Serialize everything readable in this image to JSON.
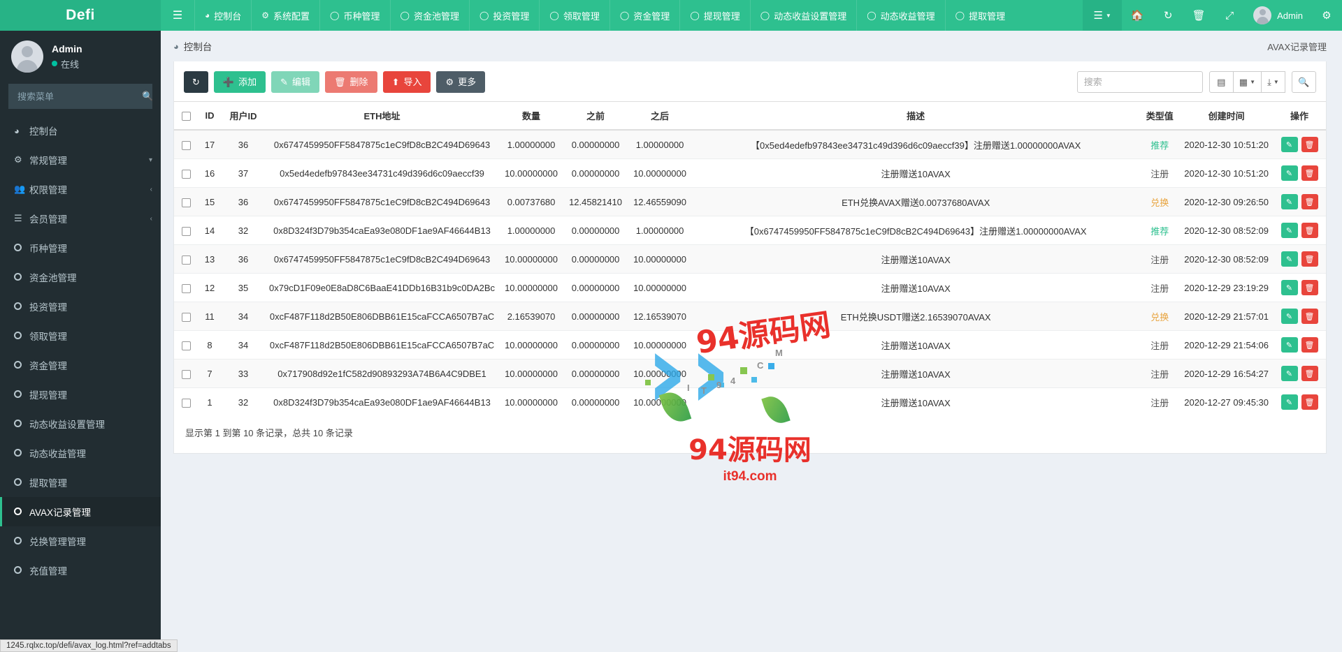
{
  "brand": "Defi",
  "topnav": {
    "toggle_icon": "hamburger-icon",
    "items": [
      {
        "label": "控制台",
        "icon": "dashboard-icon"
      },
      {
        "label": "系统配置",
        "icon": "gear-icon"
      },
      {
        "label": "币种管理",
        "icon": "circle-icon"
      },
      {
        "label": "资金池管理",
        "icon": "circle-icon"
      },
      {
        "label": "投资管理",
        "icon": "circle-icon"
      },
      {
        "label": "领取管理",
        "icon": "circle-icon"
      },
      {
        "label": "资金管理",
        "icon": "circle-icon"
      },
      {
        "label": "提现管理",
        "icon": "circle-icon"
      },
      {
        "label": "动态收益设置管理",
        "icon": "circle-icon"
      },
      {
        "label": "动态收益管理",
        "icon": "circle-icon"
      },
      {
        "label": "提取管理",
        "icon": "circle-icon"
      }
    ],
    "right": {
      "menu_icon": "list-menu-icon",
      "home_icon": "home-icon",
      "refresh_icon": "refresh-icon",
      "trash_icon": "trash-icon",
      "fullscreen_icon": "expand-icon",
      "user_label": "Admin",
      "gear_icon": "gears-icon"
    }
  },
  "sidebar": {
    "user_name": "Admin",
    "user_status": "在线",
    "search_placeholder": "搜索菜单",
    "search_value": "",
    "items": [
      {
        "label": "控制台",
        "icon": "dashboard-icon",
        "type": "icon",
        "active": false,
        "caret": ""
      },
      {
        "label": "常规管理",
        "icon": "gears-icon",
        "type": "icon",
        "active": false,
        "caret": "▾"
      },
      {
        "label": "权限管理",
        "icon": "users-icon",
        "type": "icon",
        "active": false,
        "caret": "‹"
      },
      {
        "label": "会员管理",
        "icon": "list-icon",
        "type": "icon",
        "active": false,
        "caret": "‹"
      },
      {
        "label": "币种管理",
        "icon": "circle-icon",
        "type": "circle",
        "active": false,
        "caret": ""
      },
      {
        "label": "资金池管理",
        "icon": "circle-icon",
        "type": "circle",
        "active": false,
        "caret": ""
      },
      {
        "label": "投资管理",
        "icon": "circle-icon",
        "type": "circle",
        "active": false,
        "caret": ""
      },
      {
        "label": "领取管理",
        "icon": "circle-icon",
        "type": "circle",
        "active": false,
        "caret": ""
      },
      {
        "label": "资金管理",
        "icon": "circle-icon",
        "type": "circle",
        "active": false,
        "caret": ""
      },
      {
        "label": "提现管理",
        "icon": "circle-icon",
        "type": "circle",
        "active": false,
        "caret": ""
      },
      {
        "label": "动态收益设置管理",
        "icon": "circle-icon",
        "type": "circle",
        "active": false,
        "caret": ""
      },
      {
        "label": "动态收益管理",
        "icon": "circle-icon",
        "type": "circle",
        "active": false,
        "caret": ""
      },
      {
        "label": "提取管理",
        "icon": "circle-icon",
        "type": "circle",
        "active": false,
        "caret": ""
      },
      {
        "label": "AVAX记录管理",
        "icon": "circle-icon",
        "type": "circle",
        "active": true,
        "caret": ""
      },
      {
        "label": "兑换管理管理",
        "icon": "circle-icon",
        "type": "circle",
        "active": false,
        "caret": ""
      },
      {
        "label": "充值管理",
        "icon": "circle-icon",
        "type": "circle",
        "active": false,
        "caret": ""
      }
    ]
  },
  "breadcrumb": {
    "icon": "dashboard-icon",
    "label": "控制台",
    "right_label": "AVAX记录管理"
  },
  "toolbar": {
    "refresh_icon": "refresh-icon",
    "add_label": "添加",
    "edit_label": "编辑",
    "delete_label": "删除",
    "import_label": "导入",
    "more_label": "更多",
    "search_placeholder": "搜索",
    "search_value": "",
    "icon_buttons": [
      {
        "name": "columns-toggle-icon",
        "glyph": "▤",
        "caret": false
      },
      {
        "name": "grid-view-icon",
        "glyph": "▦",
        "caret": true
      },
      {
        "name": "export-icon",
        "glyph": "⤓",
        "caret": true
      },
      {
        "name": "search-icon",
        "glyph": "⌕",
        "caret": false
      }
    ]
  },
  "table": {
    "columns": [
      "",
      "ID",
      "用户ID",
      "ETH地址",
      "数量",
      "之前",
      "之后",
      "描述",
      "类型值",
      "创建时间",
      "操作"
    ],
    "rows": [
      {
        "id": "17",
        "uid": "36",
        "eth": "0x6747459950FF5847875c1eC9fD8cB2C494D69643",
        "amount": "1.00000000",
        "before": "0.00000000",
        "after": "1.00000000",
        "desc": "【0x5ed4edefb97843ee34731c49d396d6c09aeccf39】注册赠送1.00000000AVAX",
        "type": "推荐",
        "type_class": "type-tui",
        "time": "2020-12-30 10:51:20"
      },
      {
        "id": "16",
        "uid": "37",
        "eth": "0x5ed4edefb97843ee34731c49d396d6c09aeccf39",
        "amount": "10.00000000",
        "before": "0.00000000",
        "after": "10.00000000",
        "desc": "注册赠送10AVAX",
        "type": "注册",
        "type_class": "type-zhu",
        "time": "2020-12-30 10:51:20"
      },
      {
        "id": "15",
        "uid": "36",
        "eth": "0x6747459950FF5847875c1eC9fD8cB2C494D69643",
        "amount": "0.00737680",
        "before": "12.45821410",
        "after": "12.46559090",
        "desc": "ETH兑换AVAX赠送0.00737680AVAX",
        "type": "兑换",
        "type_class": "type-dui",
        "time": "2020-12-30 09:26:50"
      },
      {
        "id": "14",
        "uid": "32",
        "eth": "0x8D324f3D79b354caEa93e080DF1ae9AF46644B13",
        "amount": "1.00000000",
        "before": "0.00000000",
        "after": "1.00000000",
        "desc": "【0x6747459950FF5847875c1eC9fD8cB2C494D69643】注册赠送1.00000000AVAX",
        "type": "推荐",
        "type_class": "type-tui",
        "time": "2020-12-30 08:52:09"
      },
      {
        "id": "13",
        "uid": "36",
        "eth": "0x6747459950FF5847875c1eC9fD8cB2C494D69643",
        "amount": "10.00000000",
        "before": "0.00000000",
        "after": "10.00000000",
        "desc": "注册赠送10AVAX",
        "type": "注册",
        "type_class": "type-zhu",
        "time": "2020-12-30 08:52:09"
      },
      {
        "id": "12",
        "uid": "35",
        "eth": "0x79cD1F09e0E8aD8C6BaaE41DDb16B31b9c0DA2Bc",
        "amount": "10.00000000",
        "before": "0.00000000",
        "after": "10.00000000",
        "desc": "注册赠送10AVAX",
        "type": "注册",
        "type_class": "type-zhu",
        "time": "2020-12-29 23:19:29"
      },
      {
        "id": "11",
        "uid": "34",
        "eth": "0xcF487F118d2B50E806DBB61E15caFCCA6507B7aC",
        "amount": "2.16539070",
        "before": "0.00000000",
        "after": "12.16539070",
        "desc": "ETH兑换USDT赠送2.16539070AVAX",
        "type": "兑换",
        "type_class": "type-dui",
        "time": "2020-12-29 21:57:01"
      },
      {
        "id": "8",
        "uid": "34",
        "eth": "0xcF487F118d2B50E806DBB61E15caFCCA6507B7aC",
        "amount": "10.00000000",
        "before": "0.00000000",
        "after": "10.00000000",
        "desc": "注册赠送10AVAX",
        "type": "注册",
        "type_class": "type-zhu",
        "time": "2020-12-29 21:54:06"
      },
      {
        "id": "7",
        "uid": "33",
        "eth": "0x717908d92e1fC582d90893293A74B6A4C9DBE1",
        "amount": "10.00000000",
        "before": "0.00000000",
        "after": "10.00000000",
        "desc": "注册赠送10AVAX",
        "type": "注册",
        "type_class": "type-zhu",
        "time": "2020-12-29 16:54:27"
      },
      {
        "id": "1",
        "uid": "32",
        "eth": "0x8D324f3D79b354caEa93e080DF1ae9AF46644B13",
        "amount": "10.00000000",
        "before": "0.00000000",
        "after": "10.00000000",
        "desc": "注册赠送10AVAX",
        "type": "注册",
        "type_class": "type-zhu",
        "time": "2020-12-27 09:45:30"
      }
    ],
    "footer": "显示第 1 到第 10 条记录，总共 10 条记录",
    "edit_icon": "pencil-icon",
    "delete_icon": "trash-icon"
  },
  "watermark": {
    "title": "94源码网",
    "overlay": "94源码网",
    "sub": "it94.com",
    "letters": [
      "I",
      "T",
      "9",
      "4",
      ".",
      "C",
      "O",
      "M"
    ]
  },
  "statusbar": {
    "text": "1245.rqlxc.top/defi/avax_log.html?ref=addtabs"
  },
  "colors": {
    "accent": "#2ec08f",
    "danger": "#e8453c",
    "sidebar_bg": "#222d32",
    "warn": "#e8a33d"
  }
}
